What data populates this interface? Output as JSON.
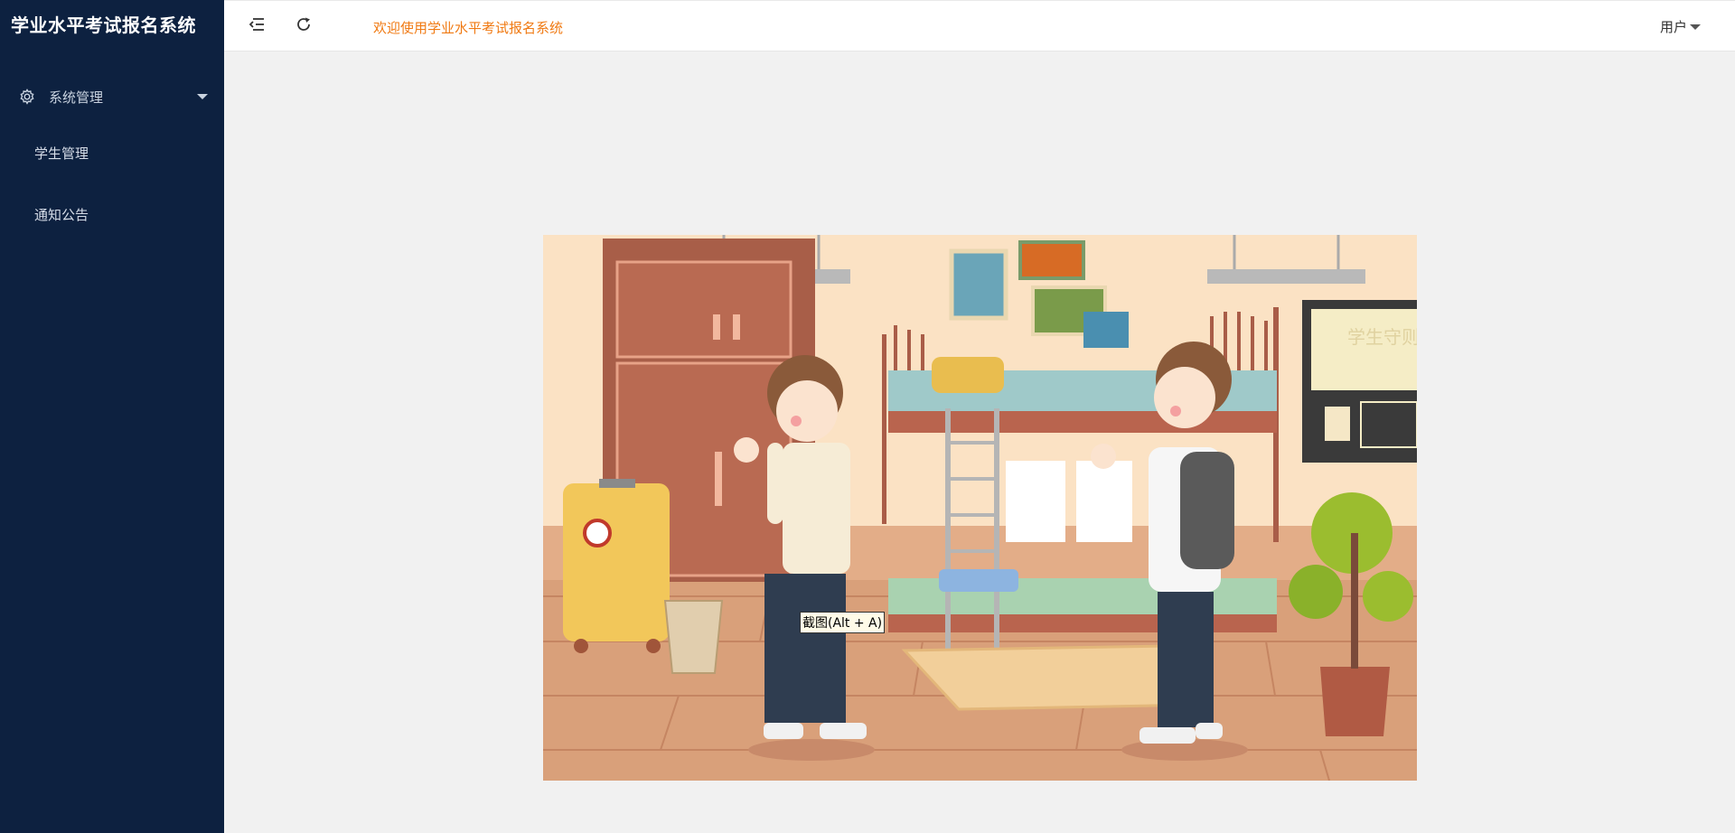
{
  "app": {
    "title": "学业水平考试报名系统"
  },
  "sidebar": {
    "group": {
      "label": "系统管理",
      "icon": "gear-icon",
      "expanded": true
    },
    "items": [
      {
        "label": "学生管理"
      },
      {
        "label": "通知公告"
      }
    ]
  },
  "header": {
    "toggle_icon": "menu-collapse-icon",
    "refresh_icon": "refresh-icon",
    "welcome": "欢迎使用学业水平考试报名系统",
    "user_label": "用户"
  },
  "tooltip": {
    "text": "截图(Alt + A)"
  },
  "illustration": {
    "poster_text": "学生守则"
  },
  "colors": {
    "sidebar_bg": "#0d2140",
    "accent": "#f07a13",
    "main_bg": "#f1f1f1"
  }
}
